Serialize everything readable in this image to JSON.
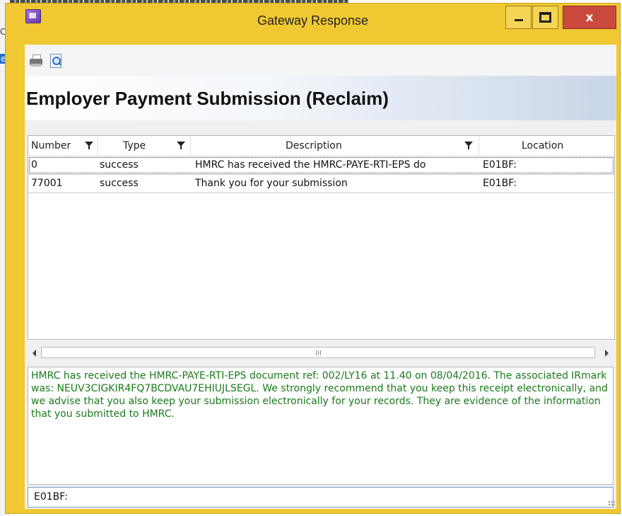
{
  "background": {
    "edge_letters": [
      "C",
      "e"
    ]
  },
  "window": {
    "title": "Gateway Response",
    "close_label": "x"
  },
  "toolbar": {
    "icons": [
      "printer-icon",
      "print-preview-icon"
    ]
  },
  "header": {
    "title": "Employer Payment Submission (Reclaim)"
  },
  "grid": {
    "columns": [
      {
        "label": "Number",
        "filter": true
      },
      {
        "label": "Type",
        "filter": true
      },
      {
        "label": "Description",
        "filter": true
      },
      {
        "label": "Location",
        "filter": false
      }
    ],
    "rows": [
      {
        "number": "0",
        "type": "success",
        "description": "HMRC has received the HMRC-PAYE-RTI-EPS do",
        "location": "E01BF:"
      },
      {
        "number": "77001",
        "type": "success",
        "description": "Thank you for your submission",
        "location": "E01BF:"
      }
    ],
    "selected_row": 0
  },
  "message": {
    "text": "HMRC has received the HMRC-PAYE-RTI-EPS document ref: 002/LY16 at 11.40 on 08/04/2016. The associated IRmark was: NEUV3CIGKIR4FQ7BCDVAU7EHIUJLSEGL. We strongly recommend that you keep this receipt electronically, and we advise that you also keep your submission electronically for your records. They are evidence of the information that you submitted to HMRC."
  },
  "status": {
    "location": "E01BF:"
  },
  "colors": {
    "titlebar": "#f0c832",
    "close_button": "#c94a3c",
    "message_text": "#1a7a1a"
  }
}
